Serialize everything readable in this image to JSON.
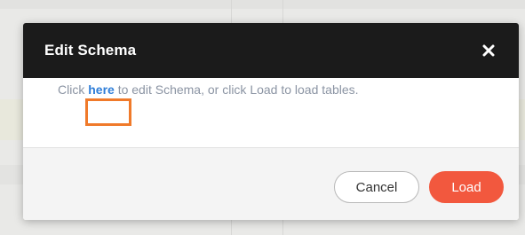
{
  "modal": {
    "title": "Edit Schema",
    "close_icon": "close-icon",
    "body": {
      "prefix": "Click ",
      "link_text": "here",
      "suffix": " to edit Schema, or click Load to load tables."
    },
    "buttons": {
      "cancel_label": "Cancel",
      "load_label": "Load"
    }
  },
  "colors": {
    "header_bg": "#1b1b1b",
    "link": "#2f7ed8",
    "highlight": "#f07a2a",
    "primary_button": "#f2583e"
  }
}
